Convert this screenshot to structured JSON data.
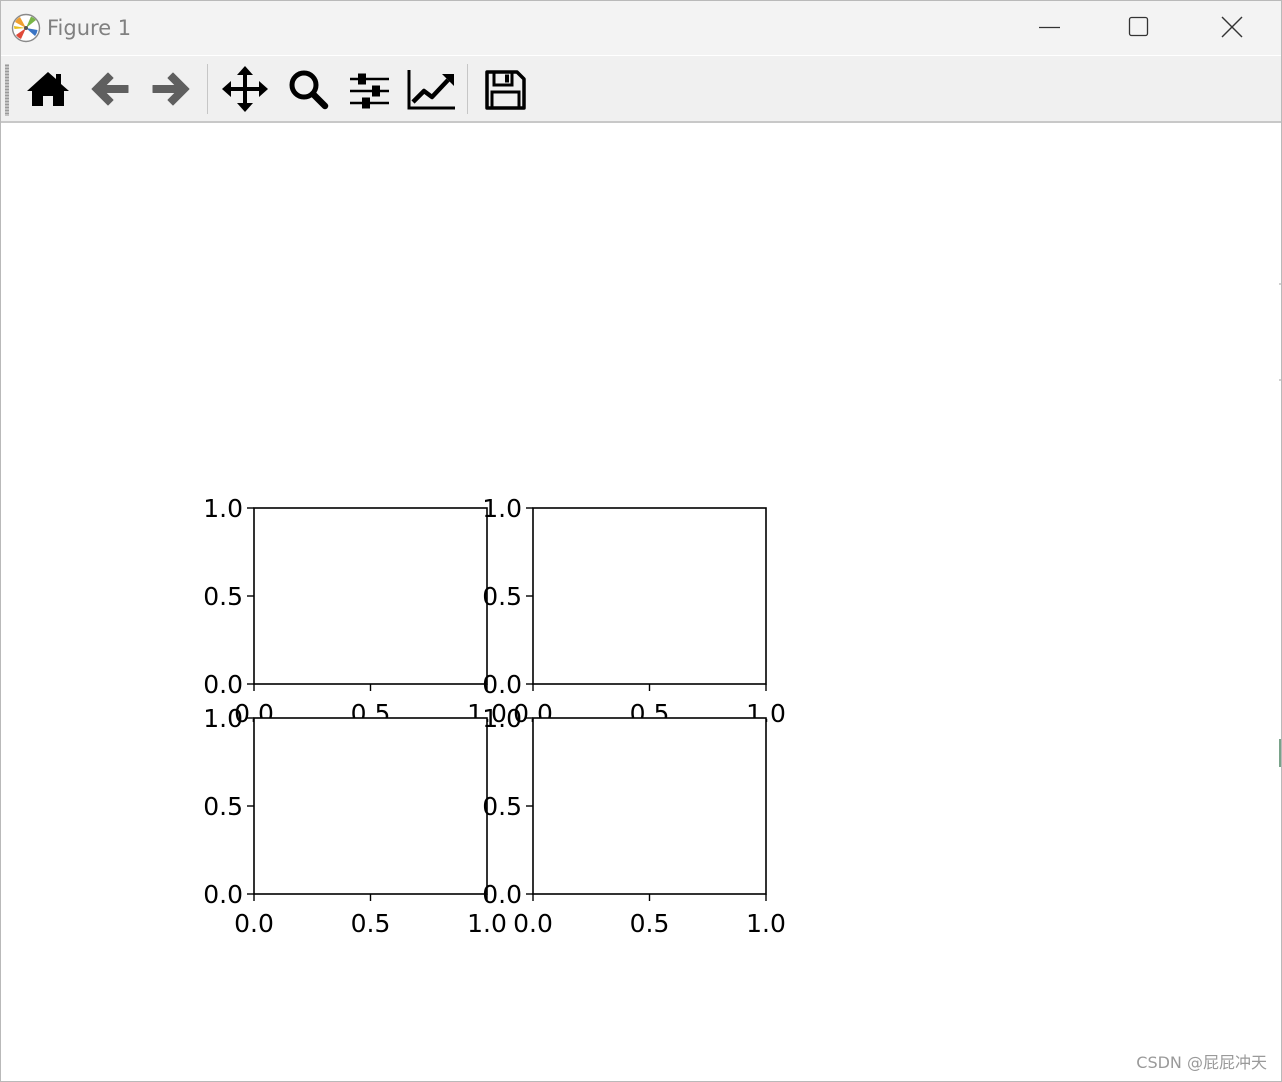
{
  "window": {
    "title": "Figure 1"
  },
  "toolbar": {
    "buttons": [
      {
        "name": "home",
        "icon": "home-icon"
      },
      {
        "name": "back",
        "icon": "arrow-left-icon"
      },
      {
        "name": "forward",
        "icon": "arrow-right-icon"
      },
      {
        "name": "pan",
        "icon": "move-icon"
      },
      {
        "name": "zoom",
        "icon": "magnifier-icon"
      },
      {
        "name": "subplots",
        "icon": "sliders-icon"
      },
      {
        "name": "customize",
        "icon": "line-chart-icon"
      },
      {
        "name": "save",
        "icon": "floppy-disk-icon"
      }
    ]
  },
  "watermark": "CSDN @屁屁冲天",
  "chart_data": [
    {
      "type": "line",
      "series": [],
      "xlim": [
        0.0,
        1.0
      ],
      "ylim": [
        0.0,
        1.0
      ],
      "xticks": [
        "0.0",
        "0.5",
        "1.0"
      ],
      "yticks": [
        "0.0",
        "0.5",
        "1.0"
      ],
      "title": "",
      "xlabel": "",
      "ylabel": ""
    },
    {
      "type": "line",
      "series": [],
      "xlim": [
        0.0,
        1.0
      ],
      "ylim": [
        0.0,
        1.0
      ],
      "xticks": [
        "0.0",
        "0.5",
        "1.0"
      ],
      "yticks": [
        "0.0",
        "0.5",
        "1.0"
      ],
      "title": "",
      "xlabel": "",
      "ylabel": ""
    },
    {
      "type": "line",
      "series": [],
      "xlim": [
        0.0,
        1.0
      ],
      "ylim": [
        0.0,
        1.0
      ],
      "xticks": [
        "0.0",
        "0.5",
        "1.0"
      ],
      "yticks": [
        "0.0",
        "0.5",
        "1.0"
      ],
      "title": "",
      "xlabel": "",
      "ylabel": ""
    },
    {
      "type": "line",
      "series": [],
      "xlim": [
        0.0,
        1.0
      ],
      "ylim": [
        0.0,
        1.0
      ],
      "xticks": [
        "0.0",
        "0.5",
        "1.0"
      ],
      "yticks": [
        "0.0",
        "0.5",
        "1.0"
      ],
      "title": "",
      "xlabel": "",
      "ylabel": ""
    }
  ]
}
